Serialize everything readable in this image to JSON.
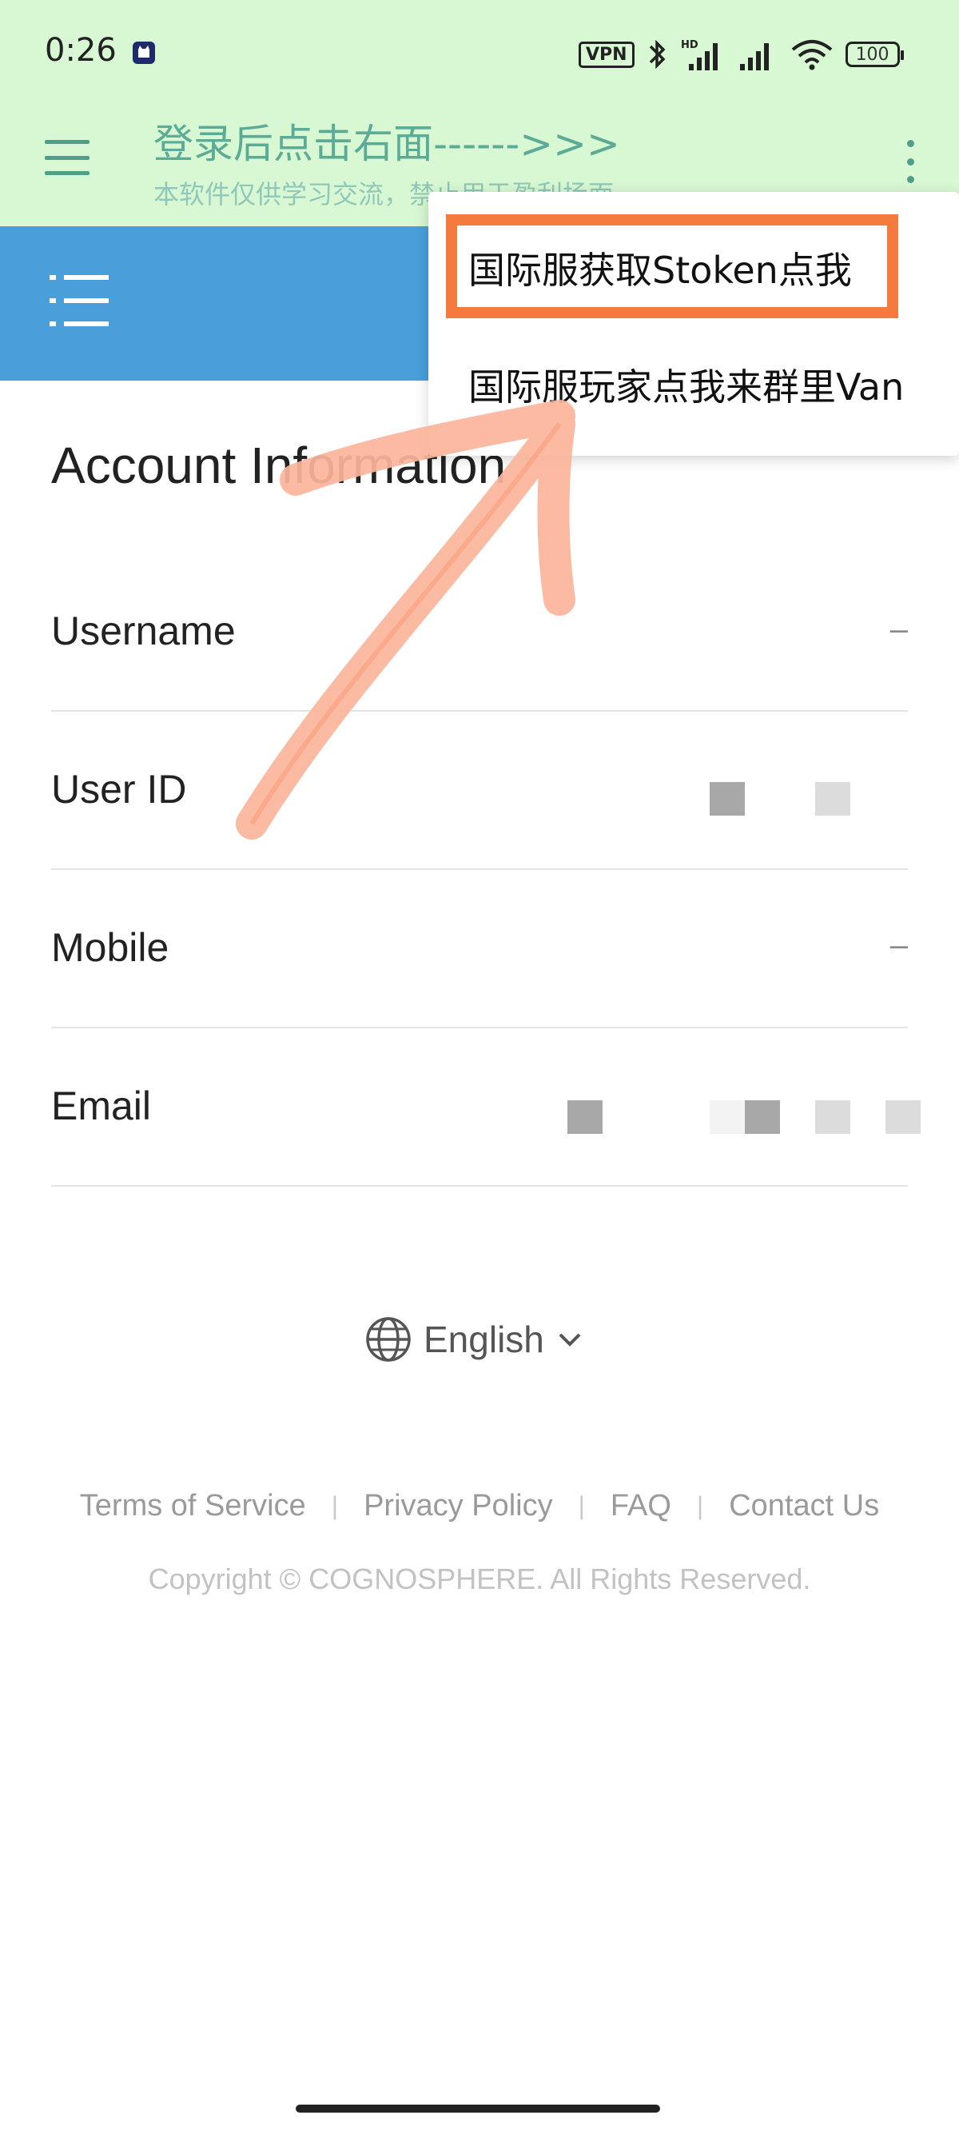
{
  "status_bar": {
    "time": "0:26",
    "vpn": "VPN",
    "hd": "HD",
    "battery": "100"
  },
  "app_header": {
    "title": "登录后点击右面------>>>",
    "subtitle": "本软件仅供学习交流，禁止用于盈利场面"
  },
  "popup_menu": {
    "items": [
      {
        "label": "国际服获取Stoken点我",
        "highlighted": true
      },
      {
        "label": "国际服玩家点我来群里Van",
        "highlighted": false
      }
    ]
  },
  "account": {
    "title": "Account Information",
    "rows": [
      {
        "label": "Username",
        "value": "–"
      },
      {
        "label": "User ID",
        "value": ""
      },
      {
        "label": "Mobile",
        "value": "–"
      },
      {
        "label": "Email",
        "value": ""
      }
    ]
  },
  "language": {
    "current": "English"
  },
  "footer": {
    "links": [
      "Terms of Service",
      "Privacy Policy",
      "FAQ",
      "Contact Us"
    ],
    "copyright": "Copyright © COGNOSPHERE. All Rights Reserved."
  },
  "colors": {
    "header_bg": "#d8f8d3",
    "web_header_bg": "#4a9fdb",
    "title_green": "#5bab97",
    "annotation_orange": "#f57a3e",
    "arrow_salmon": "#fbb59a"
  }
}
